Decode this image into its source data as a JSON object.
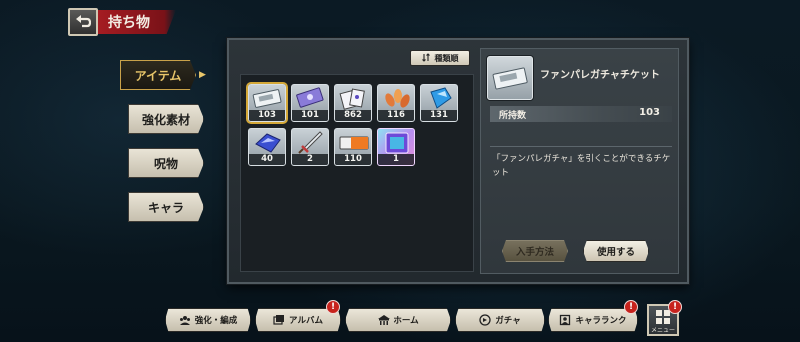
{
  "header": {
    "title": "持ち物",
    "back_icon": "back-arrow-icon"
  },
  "tabs": [
    {
      "label": "アイテム",
      "active": true
    },
    {
      "label": "強化素材",
      "active": false
    },
    {
      "label": "呪物",
      "active": false
    },
    {
      "label": "キャラ",
      "active": false
    }
  ],
  "sort": {
    "label": "種類順",
    "icon": "sort-icon"
  },
  "items": [
    {
      "icon": "ticket-icon",
      "count": "103",
      "selected": true
    },
    {
      "icon": "ticket-purple-icon",
      "count": "101",
      "selected": false
    },
    {
      "icon": "cards-icon",
      "count": "862",
      "selected": false
    },
    {
      "icon": "leaves-icon",
      "count": "116",
      "selected": false
    },
    {
      "icon": "blue-crystal-icon",
      "count": "131",
      "selected": false
    },
    {
      "icon": "blue-gem-icon",
      "count": "40",
      "selected": false
    },
    {
      "icon": "sword-icon",
      "count": "2",
      "selected": false
    },
    {
      "icon": "orange-ticket-icon",
      "count": "110",
      "selected": false
    },
    {
      "icon": "rainbow-card-icon",
      "count": "1",
      "selected": false
    }
  ],
  "detail": {
    "name": "ファンパレガチャチケット",
    "count_label": "所持数",
    "count_value": "103",
    "description": "「ファンパレガチャ」を引くことができるチケット",
    "how_to_get_label": "入手方法",
    "use_label": "使用する"
  },
  "bottom_nav": [
    {
      "label": "強化・編成",
      "icon": "team-icon",
      "alert": false
    },
    {
      "label": "アルバム",
      "icon": "album-icon",
      "alert": true
    },
    {
      "label": "ホーム",
      "icon": "home-icon",
      "alert": false
    },
    {
      "label": "ガチャ",
      "icon": "gacha-icon",
      "alert": false
    },
    {
      "label": "キャラランク",
      "icon": "rank-icon",
      "alert": true
    }
  ],
  "menu": {
    "label": "メニュー",
    "alert": true,
    "icon": "grid-menu-icon"
  },
  "colors": {
    "accent_gold": "#d4a838",
    "alert_red": "#c7231d",
    "title_red": "#a51c22"
  }
}
